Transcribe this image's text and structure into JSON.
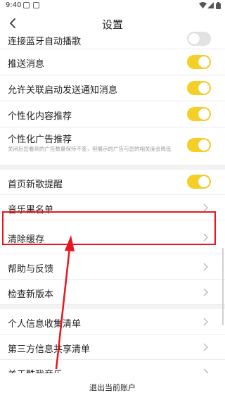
{
  "status_bar": {
    "time": "9:40",
    "notif_icons": [
      "app-icon",
      "image-icon"
    ]
  },
  "header": {
    "title": "设置"
  },
  "settings": [
    {
      "label": "连接蓝牙自动播歌",
      "type": "toggle",
      "on": false
    },
    {
      "label": "推送消息",
      "type": "toggle",
      "on": true
    },
    {
      "label": "允许关联启动发送通知消息",
      "type": "toggle",
      "on": true
    },
    {
      "label": "个性化内容推荐",
      "type": "toggle",
      "on": true
    },
    {
      "label": "个性化广告推荐",
      "description": "关闭后您看到的广告数量保持不变，但展示的广告与您的相关度会降低",
      "type": "toggle",
      "on": true
    },
    {
      "label": "首页新歌提醒",
      "type": "toggle",
      "on": true
    },
    {
      "label": "音乐黑名单",
      "type": "link"
    },
    {
      "label": "清除缓存",
      "type": "link"
    },
    {
      "label": "帮助与反馈",
      "type": "link"
    },
    {
      "label": "检查新版本",
      "type": "link"
    },
    {
      "label": "个人信息收集清单",
      "type": "link"
    },
    {
      "label": "第三方信息共享清单",
      "type": "link"
    },
    {
      "label": "关于酷我音乐",
      "type": "link"
    }
  ],
  "footer": {
    "logout_label": "退出当前账户"
  },
  "colors": {
    "toggle_on": "#f6cf26",
    "toggle_off": "#e2e2e2",
    "annotation": "#e8161e"
  }
}
